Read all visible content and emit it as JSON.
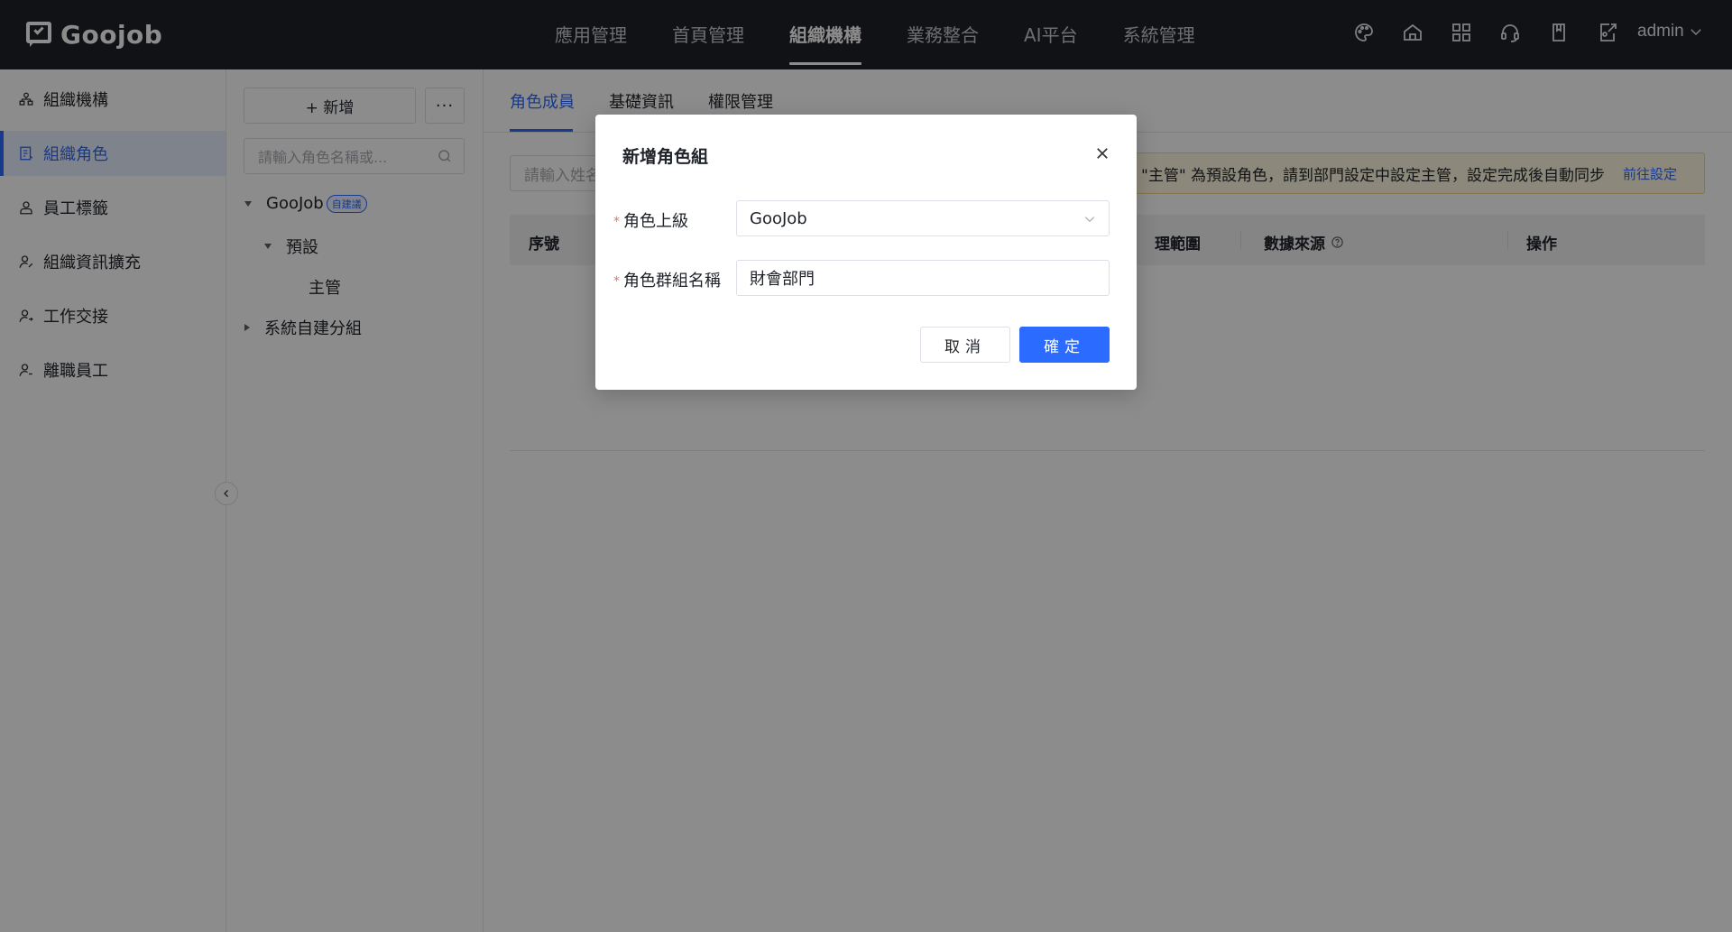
{
  "brand": {
    "logo_text": "Goojob"
  },
  "topnav": {
    "items": [
      {
        "label": "應用管理"
      },
      {
        "label": "首頁管理"
      },
      {
        "label": "組織機構"
      },
      {
        "label": "業務整合"
      },
      {
        "label": "AI平台"
      },
      {
        "label": "系統管理"
      }
    ],
    "active_index": 2
  },
  "header": {
    "icons": [
      "palette-icon",
      "home-icon",
      "apps-grid-icon",
      "headset-icon",
      "book-icon",
      "export-icon"
    ],
    "user": "admin"
  },
  "sidebar": {
    "items": [
      {
        "label": "組織機構",
        "icon": "org-icon"
      },
      {
        "label": "組織角色",
        "icon": "role-icon"
      },
      {
        "label": "員工標籤",
        "icon": "tag-icon"
      },
      {
        "label": "組織資訊擴充",
        "icon": "user-edit-icon"
      },
      {
        "label": "工作交接",
        "icon": "handover-icon"
      },
      {
        "label": "離職員工",
        "icon": "user-leave-icon"
      }
    ],
    "active_index": 1
  },
  "tree": {
    "add_label": "+ 新增",
    "more_label": "···",
    "search_placeholder": "請輸入角色名稱或...",
    "root": {
      "label": "GooJob",
      "tag": "自建議"
    },
    "default_group": "預設",
    "default_child": "主管",
    "custom_group": "系統自建分組"
  },
  "main": {
    "tabs": [
      "角色成員",
      "基礎資訊",
      "權限管理"
    ],
    "active_tab": 0,
    "member_search_placeholder": "請輸入姓名",
    "notice": {
      "text": "\"主管\" 為預設角色，請到部門設定中設定主管，設定完成後自動同步",
      "link": "前往設定"
    },
    "columns": {
      "index": "序號",
      "scope": "理範圍",
      "source": "數據來源",
      "action": "操作"
    }
  },
  "dialog": {
    "title": "新增角色組",
    "parent_label": "角色上級",
    "parent_value": "GooJob",
    "name_label": "角色群組名稱",
    "name_value": "財會部門",
    "cancel_label": "取消",
    "ok_label": "確定"
  }
}
